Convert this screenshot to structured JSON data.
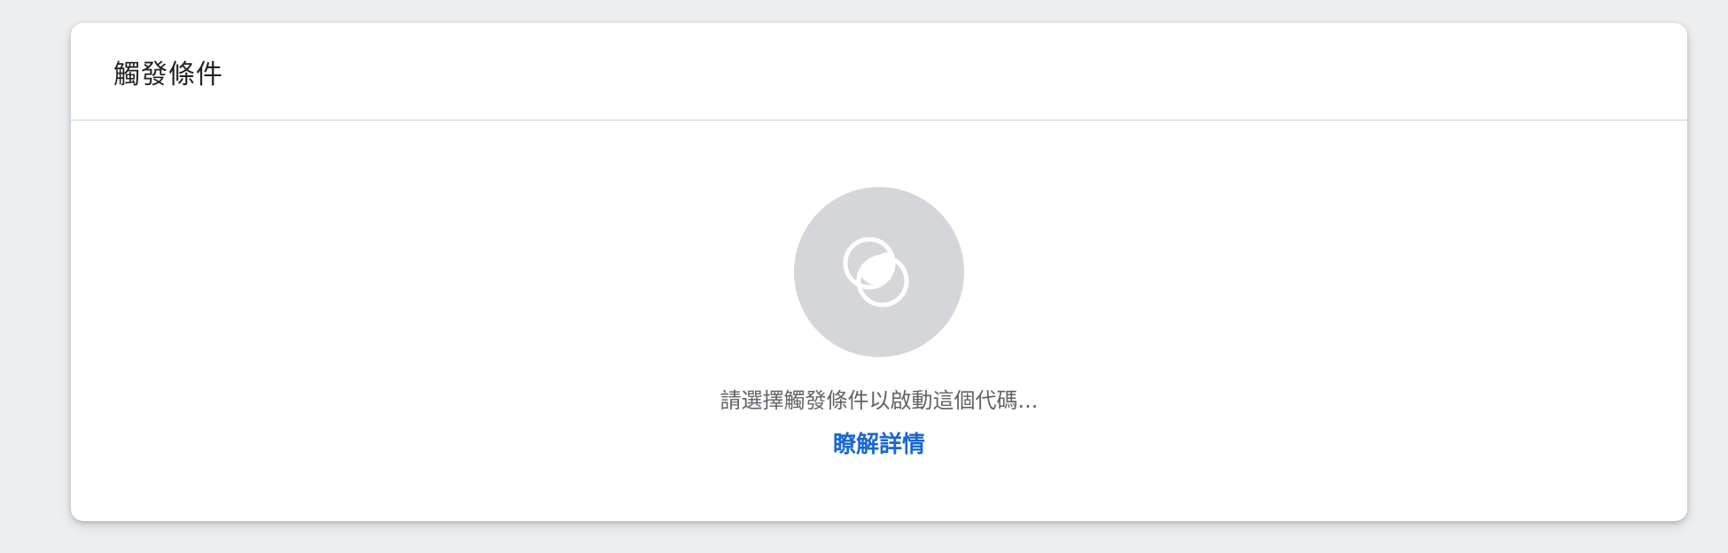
{
  "panel": {
    "title": "觸發條件"
  },
  "empty_state": {
    "icon": "trigger-icon",
    "message": "請選擇觸發條件以啟動這個代碼...",
    "learn_more_label": "瞭解詳情"
  },
  "colors": {
    "background": "#eceef0",
    "card": "#ffffff",
    "icon_circle": "#d4d6d9",
    "link": "#1a67d2"
  }
}
